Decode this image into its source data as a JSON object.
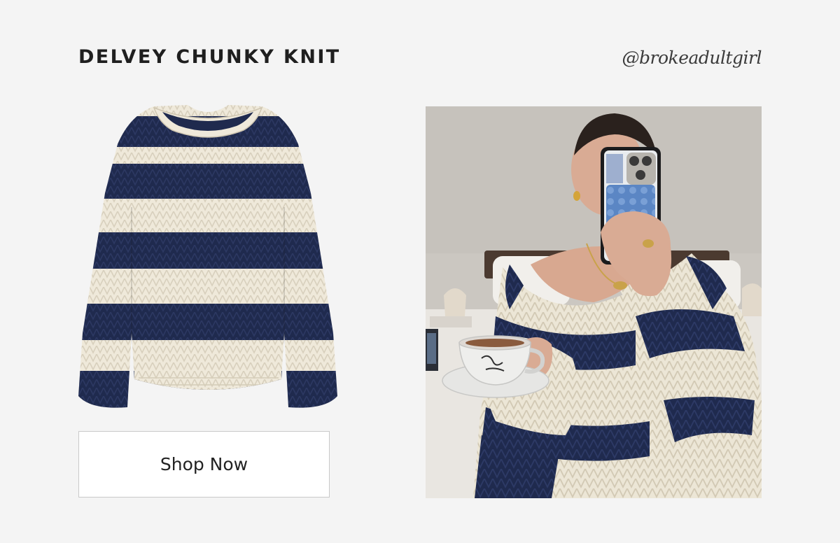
{
  "header": {
    "title": "DELVEY CHUNKY KNIT",
    "handle": "@brokeadultgirl"
  },
  "cta": {
    "label": "Shop Now"
  },
  "colors": {
    "background": "#f4f4f4",
    "navy": "#1f2a4e",
    "cream": "#ece6d6"
  }
}
